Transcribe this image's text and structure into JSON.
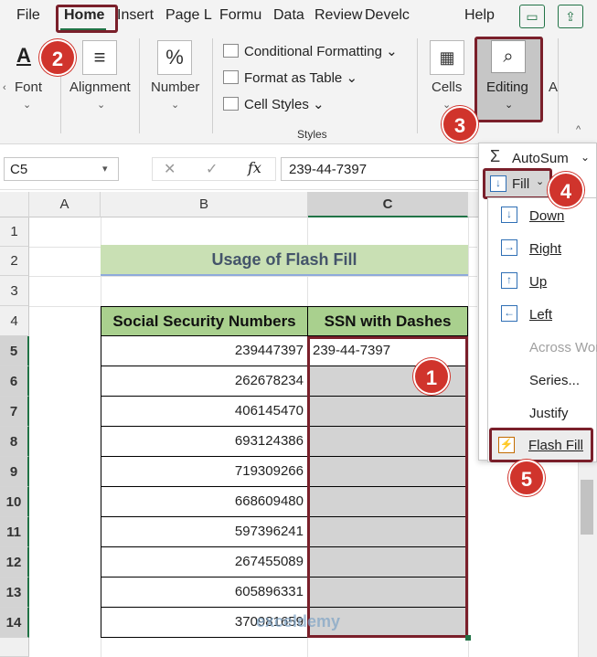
{
  "tabs": [
    "File",
    "Home",
    "Insert",
    "Page L",
    "Formu",
    "Data",
    "Review",
    "Develc",
    "Help"
  ],
  "ribbon": {
    "font_label": "Font",
    "alignment_label": "Alignment",
    "number_label": "Number",
    "conditional_formatting": "Conditional Formatting",
    "format_as_table": "Format as Table",
    "cell_styles": "Cell Styles",
    "styles_group": "Styles",
    "cells_label": "Cells",
    "editing_label": "Editing",
    "cut_off_label": "A",
    "number_icon": "%"
  },
  "formula_bar": {
    "name_box": "C5",
    "fx": "fx",
    "formula": "239-44-7397"
  },
  "columns": [
    "A",
    "B",
    "C"
  ],
  "rows": [
    "1",
    "2",
    "3",
    "4",
    "5",
    "6",
    "7",
    "8",
    "9",
    "10",
    "11",
    "12",
    "13",
    "14"
  ],
  "sheet": {
    "title": "Usage of Flash Fill",
    "header_b": "Social Security Numbers",
    "header_c": "SSN with Dashes",
    "ssn": [
      "239447397",
      "262678234",
      "406145470",
      "693124386",
      "719309266",
      "668609480",
      "597396241",
      "267455089",
      "605896331",
      "370981659"
    ],
    "c5": "239-44-7397"
  },
  "menu": {
    "autosum": "AutoSum",
    "fill": "Fill",
    "down": "Down",
    "right": "Right",
    "up": "Up",
    "left": "Left",
    "across": "Across Wor",
    "series": "Series...",
    "justify": "Justify",
    "flash_fill": "Flash Fill"
  },
  "badges": [
    "1",
    "2",
    "3",
    "4",
    "5"
  ],
  "watermark": "exceldemy",
  "colors": {
    "accent": "#217346",
    "annotation": "#7a1f2a",
    "badge": "#d0342c",
    "header_green": "#a9d08e",
    "title_green": "#c9e0b4"
  }
}
